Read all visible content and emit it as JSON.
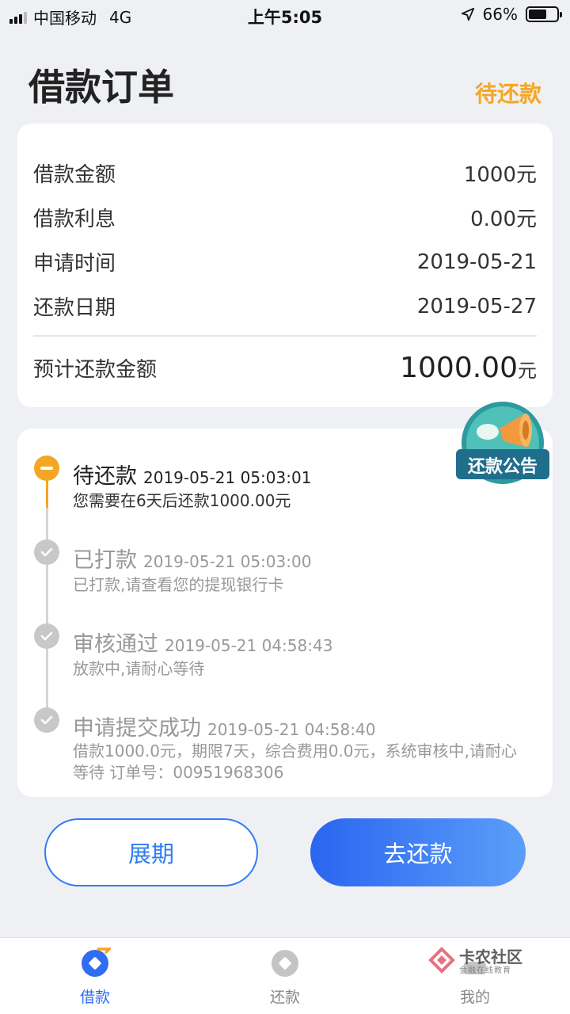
{
  "status_bar": {
    "carrier": "中国移动",
    "network": "4G",
    "time": "上午5:05",
    "battery": "66%"
  },
  "header": {
    "title": "借款订单",
    "status": "待还款"
  },
  "summary": {
    "rows": [
      {
        "label": "借款金额",
        "value": "1000元"
      },
      {
        "label": "借款利息",
        "value": "0.00元"
      },
      {
        "label": "申请时间",
        "value": "2019-05-21"
      },
      {
        "label": "还款日期",
        "value": "2019-05-27"
      }
    ],
    "total_label": "预计还款金额",
    "total_value": "1000.00",
    "total_unit": "元"
  },
  "timeline": [
    {
      "title": "待还款",
      "time": "2019-05-21 05:03:01",
      "desc": "您需要在6天后还款1000.00元",
      "state": "current"
    },
    {
      "title": "已打款",
      "time": "2019-05-21 05:03:00",
      "desc": "已打款,请查看您的提现银行卡",
      "state": "done"
    },
    {
      "title": "审核通过",
      "time": "2019-05-21 04:58:43",
      "desc": "放款中,请耐心等待",
      "state": "done"
    },
    {
      "title": "申请提交成功",
      "time": "2019-05-21 04:58:40",
      "desc": "借款1000.0元，期限7天，综合费用0.0元，系统审核中,请耐心等待 订单号：00951968306",
      "state": "done"
    }
  ],
  "promo": {
    "label": "还款公告"
  },
  "buttons": {
    "extend": "展期",
    "repay": "去还款"
  },
  "tabbar": {
    "items": [
      {
        "label": "借款",
        "icon": "loan-icon",
        "active": true
      },
      {
        "label": "还款",
        "icon": "repay-icon",
        "active": false
      },
      {
        "label": "我的",
        "icon": "profile-icon",
        "active": false
      }
    ]
  },
  "watermark": {
    "main": "卡农社区",
    "sub": "金融在线教育"
  },
  "colors": {
    "accent": "#2f7cf6",
    "warning": "#f5a623",
    "background": "#eef0f4"
  }
}
